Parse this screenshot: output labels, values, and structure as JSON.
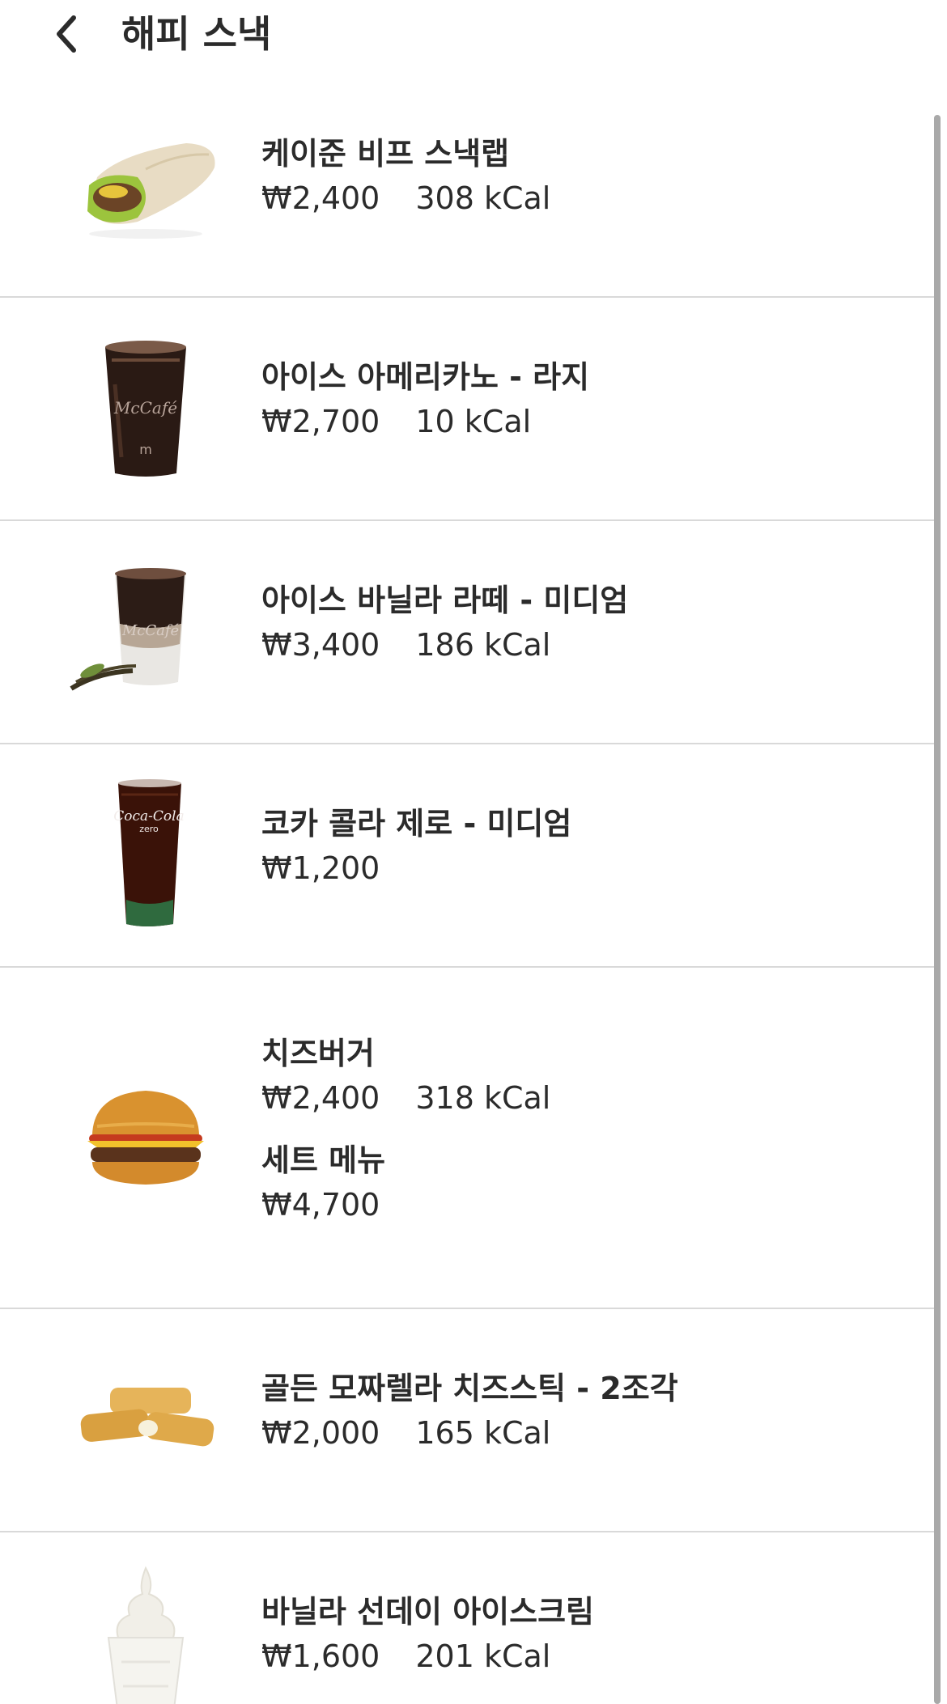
{
  "header": {
    "title": "해피 스낵",
    "back_icon": "chevron-left-icon"
  },
  "items": [
    {
      "name": "케이준 비프 스낵랩",
      "price": "₩2,400",
      "kcal": "308 kCal",
      "image": "wrap-image"
    },
    {
      "name": "아이스 아메리카노 - 라지",
      "price": "₩2,700",
      "kcal": "10 kCal",
      "image": "iced-coffee-image",
      "cup_text": "McCafé"
    },
    {
      "name": "아이스 바닐라 라떼 - 미디엄",
      "price": "₩3,400",
      "kcal": "186 kCal",
      "image": "vanilla-latte-image",
      "cup_text": "McCafé"
    },
    {
      "name": "코카 콜라 제로 - 미디엄",
      "price": "₩1,200",
      "kcal": "",
      "image": "coke-zero-image",
      "cup_text": "Coca-Cola",
      "cup_sub_text": "zero"
    },
    {
      "name": "치즈버거",
      "price": "₩2,400",
      "kcal": "318 kCal",
      "image": "cheeseburger-image",
      "set_label": "세트 메뉴",
      "set_price": "₩4,700"
    },
    {
      "name": "골든 모짜렐라 치즈스틱 - 2조각",
      "price": "₩2,000",
      "kcal": "165 kCal",
      "image": "cheese-sticks-image"
    },
    {
      "name": "바닐라 선데이 아이스크림",
      "price": "₩1,600",
      "kcal": "201 kCal",
      "image": "sundae-image"
    }
  ]
}
